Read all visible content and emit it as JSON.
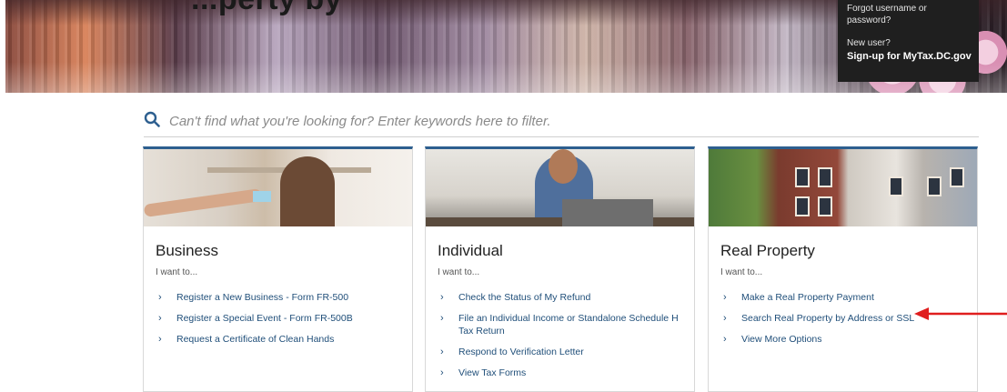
{
  "banner": {
    "title_fragment": "...perty by",
    "login": {
      "forgot_label": "Forgot username or password?",
      "new_user_label": "New user?",
      "signup_label": "Sign-up for MyTax.DC.gov"
    }
  },
  "search": {
    "placeholder": "Can't find what you're looking for? Enter keywords here to filter.",
    "icon": "search-icon"
  },
  "cards": [
    {
      "title": "Business",
      "subtitle": "I want to...",
      "links": [
        "Register a New Business - Form FR-500",
        "Register a Special Event - Form FR-500B",
        "Request a Certificate of Clean Hands"
      ]
    },
    {
      "title": "Individual",
      "subtitle": "I want to...",
      "links": [
        "Check the Status of My Refund",
        "File an Individual Income or Standalone Schedule H Tax Return",
        "Respond to Verification Letter",
        "View Tax Forms"
      ]
    },
    {
      "title": "Real Property",
      "subtitle": "I want to...",
      "links": [
        "Make a Real Property Payment",
        "Search Real Property by Address or SSL",
        "View More Options"
      ]
    }
  ],
  "colors": {
    "accent": "#2d5f8f",
    "link": "#1f4e79",
    "annotation_arrow": "#e01e1e"
  }
}
